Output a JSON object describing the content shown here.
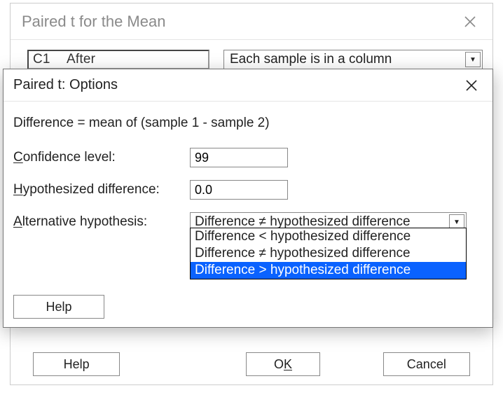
{
  "outer": {
    "title": "Paired t for the Mean",
    "list_col": "C1",
    "list_name": "After",
    "layout_select": "Each sample is in a column",
    "help": "Help",
    "ok_pre": "O",
    "ok_mnemonic": "K",
    "cancel": "Cancel"
  },
  "inner": {
    "title": "Paired t: Options",
    "diff_text": "Difference = mean of (sample 1 - sample 2)",
    "conf_label_mnemonic": "C",
    "conf_label_rest": "onfidence level:",
    "conf_value": "99",
    "hyp_label_mnemonic": "H",
    "hyp_label_rest": "ypothesized difference:",
    "hyp_value": "0.0",
    "alt_label_mnemonic": "A",
    "alt_label_rest": "lternative hypothesis:",
    "alt_selected": "Difference ≠ hypothesized difference",
    "options": [
      "Difference < hypothesized difference",
      "Difference ≠ hypothesized difference",
      "Difference > hypothesized difference"
    ],
    "highlight_index": 2,
    "help": "Help"
  }
}
